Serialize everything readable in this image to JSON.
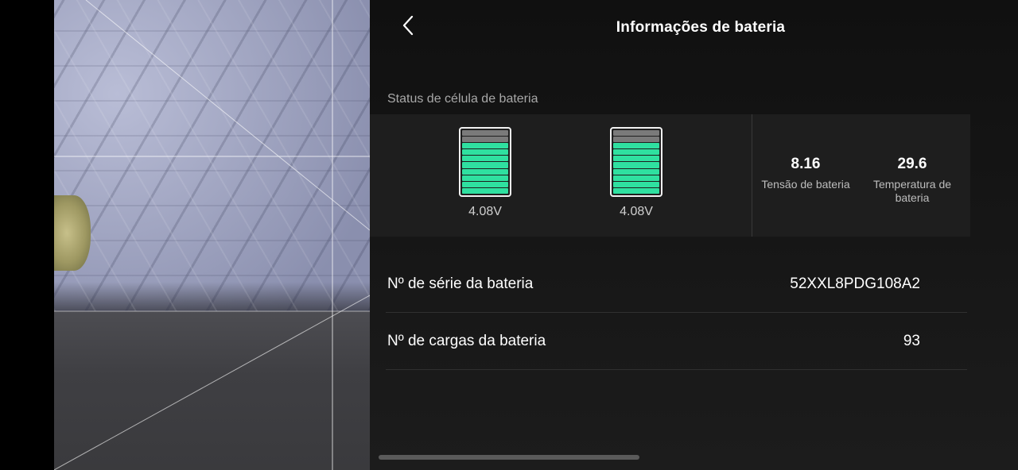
{
  "header": {
    "title": "Informações de bateria"
  },
  "cell_status": {
    "label": "Status de célula de bateria",
    "cells": [
      {
        "voltage": "4.08V",
        "level_fraction": 0.8
      },
      {
        "voltage": "4.08V",
        "level_fraction": 0.8
      }
    ],
    "voltage_value": "8.16",
    "voltage_label": "Tensão de bateria",
    "temperature_value": "29.6",
    "temperature_label": "Temperatura de bateria"
  },
  "info_rows": [
    {
      "label": "Nº de série da bateria",
      "value": "52XXL8PDG108A2"
    },
    {
      "label": "Nº de cargas da bateria",
      "value": "93"
    }
  ],
  "colors": {
    "accent": "#2fe0a0",
    "panel": "#151515"
  },
  "icons": {
    "back": "chevron-left-icon",
    "battery": "battery-cell-icon"
  }
}
